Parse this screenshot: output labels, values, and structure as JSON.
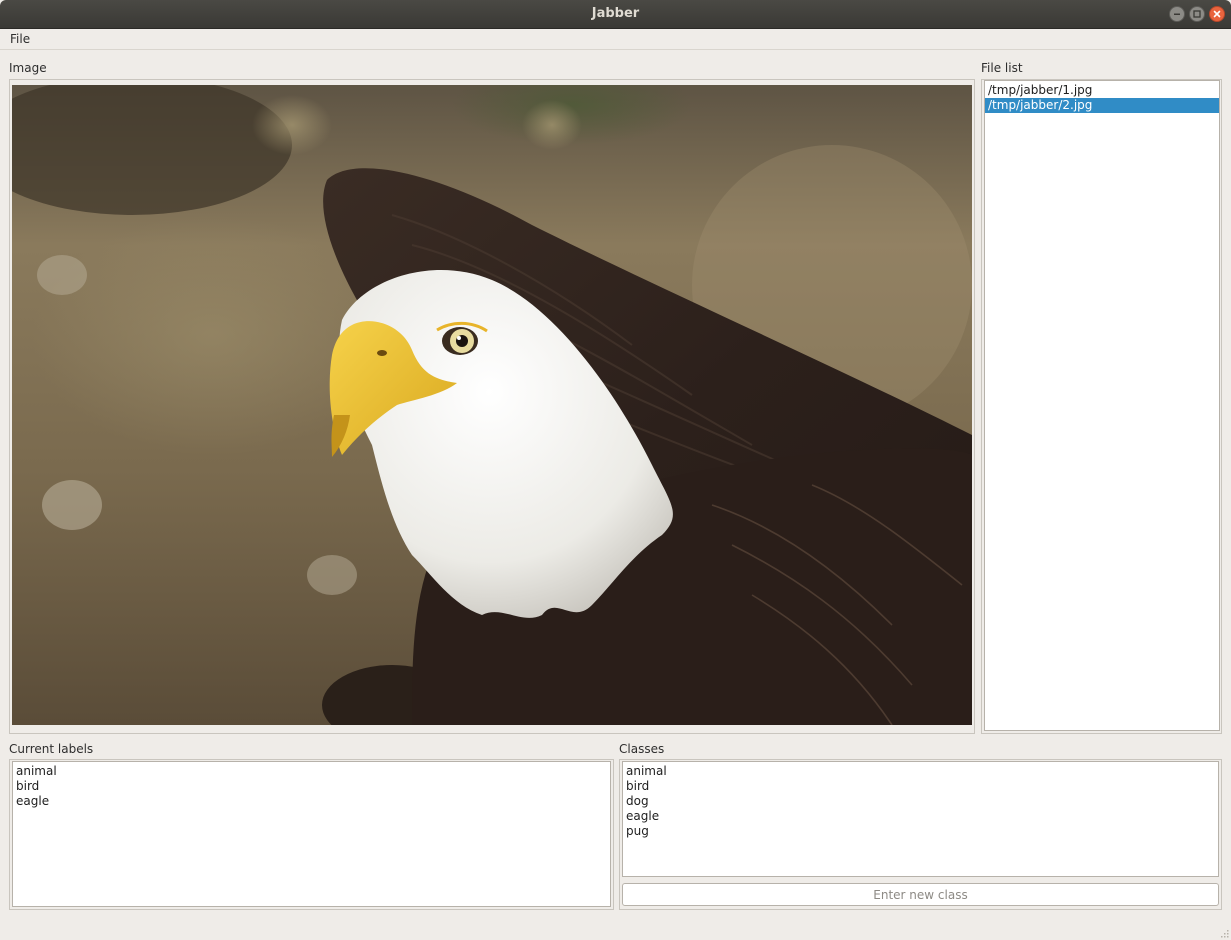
{
  "window": {
    "title": "Jabber"
  },
  "menu": {
    "file": "File"
  },
  "image_panel": {
    "label": "Image"
  },
  "file_list": {
    "label": "File list",
    "items": [
      {
        "text": "/tmp/jabber/1.jpg",
        "selected": false
      },
      {
        "text": "/tmp/jabber/2.jpg",
        "selected": true
      }
    ]
  },
  "current_labels": {
    "label": "Current labels",
    "items": [
      "animal",
      "bird",
      "eagle"
    ]
  },
  "classes": {
    "label": "Classes",
    "items": [
      "animal",
      "bird",
      "dog",
      "eagle",
      "pug"
    ],
    "new_class_placeholder": "Enter new class"
  },
  "colors": {
    "selection": "#308cc6",
    "window_bg": "#efece8",
    "titlebar": "#3f3e3a",
    "close": "#e9643e"
  }
}
